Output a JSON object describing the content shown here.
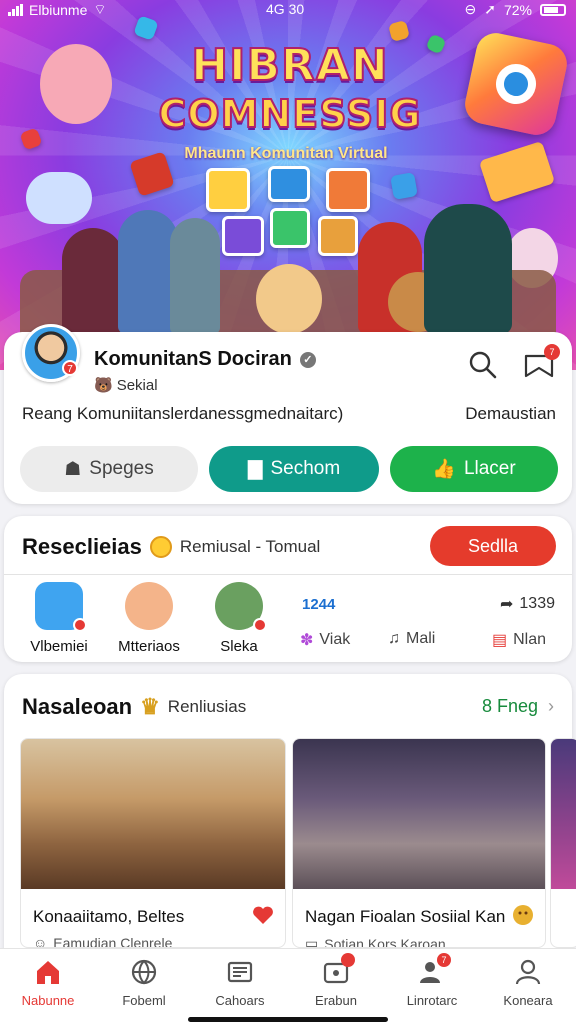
{
  "statusbar": {
    "carrier": "Elbiunme",
    "time": "4G 30",
    "battery": "72%"
  },
  "hero": {
    "title_line1": "HIBRAN",
    "title_line2": "COMNESSIG",
    "subtitle": "Mhaunn Komunitan Virtual"
  },
  "profile": {
    "name": "KomunitanS Dociran",
    "category": "Sekial",
    "description": "Reang Komuniitanslerdanessgmednaitarc)",
    "link": "Demaustian",
    "notif_count": "7",
    "inbox_count": "7",
    "buttons": {
      "gray": "Speges",
      "teal": "Sechom",
      "green": "Llacer"
    }
  },
  "recommend": {
    "title": "Reseclieias",
    "subtitle": "Remiusal - Tomual",
    "action": "Sedlla",
    "members": [
      {
        "label": "Vlbemiei"
      },
      {
        "label": "Mtteriaos"
      },
      {
        "label": "Sleka"
      }
    ],
    "stat_count": "1244",
    "share_count": "1339",
    "actions": [
      {
        "label": "Viak"
      },
      {
        "label": "Mali"
      },
      {
        "label": "Nlan"
      }
    ]
  },
  "feed": {
    "title": "Nasaleoan",
    "subtitle": "Renliusias",
    "link": "8 Fneg",
    "posts": [
      {
        "title": "Konaaiitamo, Beltes",
        "meta": "Eamudian  Clenrele"
      },
      {
        "title": "Nagan Fioalan Sosiial Kan",
        "meta": "Sotian  Kors  Karoan"
      }
    ]
  },
  "nav": [
    {
      "label": "Nabunne"
    },
    {
      "label": "Fobeml"
    },
    {
      "label": "Cahoars"
    },
    {
      "label": "Erabun"
    },
    {
      "label": "Linrotarc"
    },
    {
      "label": "Koneara"
    }
  ],
  "colors": {
    "accent_red": "#e53935",
    "teal": "#0f9b8a",
    "green": "#1db24b",
    "link_green": "#178a3c",
    "blue_stat": "#1c6fd0"
  }
}
